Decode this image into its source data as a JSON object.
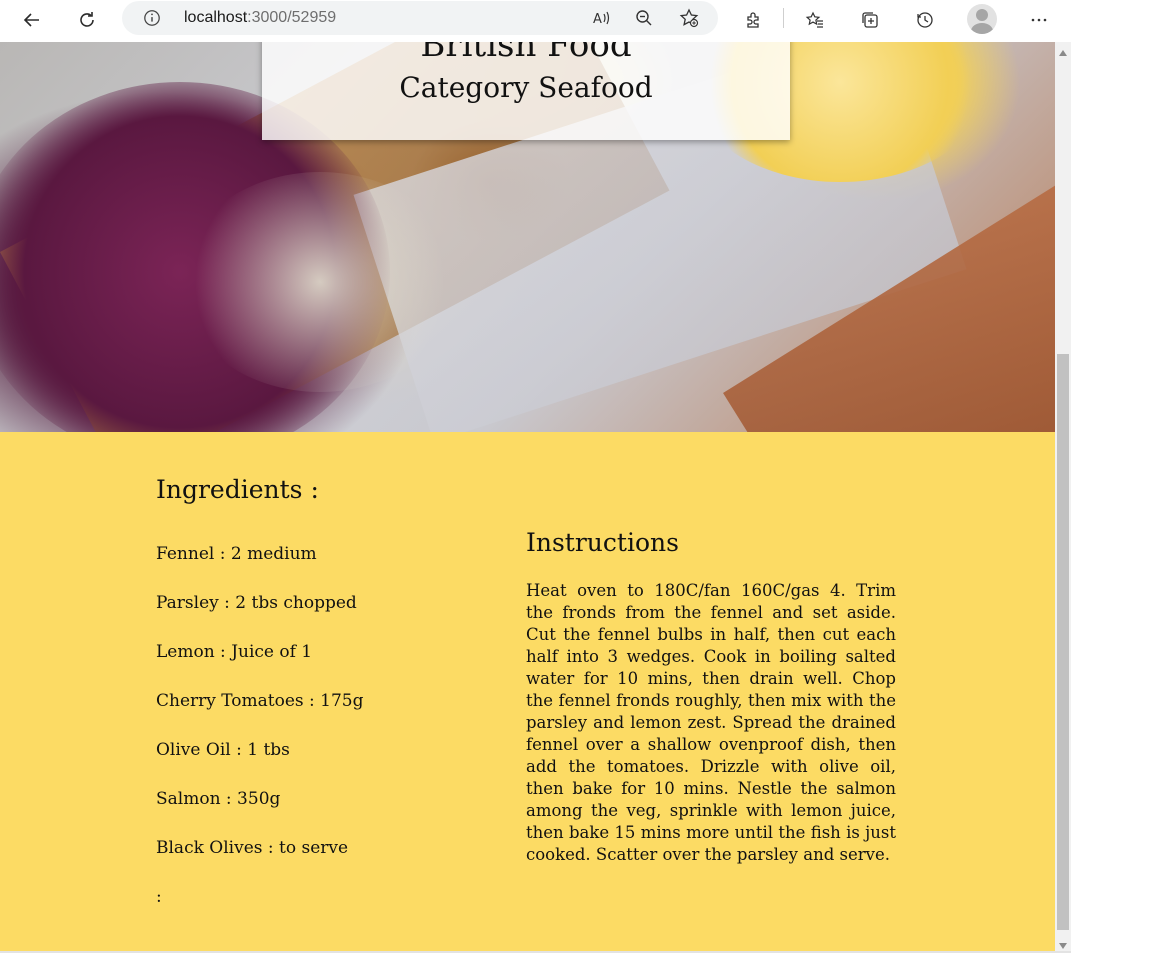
{
  "browser": {
    "url_host": "localhost",
    "url_path": ":3000/52959",
    "icons": {
      "back": "back-arrow-icon",
      "refresh": "refresh-icon",
      "info": "info-icon",
      "read_aloud": "read-aloud-icon",
      "zoom": "zoom-out-icon",
      "favorite_add": "add-favorite-icon",
      "extensions": "extensions-icon",
      "favorites": "favorites-icon",
      "collections": "collections-icon",
      "history": "history-icon",
      "profile": "profile-avatar-icon",
      "more": "more-icon"
    }
  },
  "recipe": {
    "area_title": "British Food",
    "category_title": "Category Seafood",
    "ingredients_heading": "Ingredients :",
    "ingredients": [
      "Fennel : 2 medium",
      "Parsley : 2 tbs chopped",
      "Lemon : Juice of 1",
      "Cherry Tomatoes : 175g",
      "Olive Oil : 1 tbs",
      "Salmon : 350g",
      "Black Olives : to serve",
      ":"
    ],
    "instructions_heading": "Instructions",
    "instructions": "Heat oven to 180C/fan 160C/gas 4. Trim the fronds from the fennel and set aside. Cut the fennel bulbs in half, then cut each half into 3 wedges. Cook in boiling salted water for 10 mins, then drain well. Chop the fennel fronds roughly, then mix with the parsley and lemon zest. Spread the drained fennel over a shallow ovenproof dish, then add the tomatoes. Drizzle with olive oil, then bake for 10 mins. Nestle the salmon among the veg, sprinkle with lemon juice, then bake 15 mins more until the fish is just cooked. Scatter over the parsley and serve."
  },
  "colors": {
    "content_background": "#fcdb64",
    "text": "#111111"
  }
}
